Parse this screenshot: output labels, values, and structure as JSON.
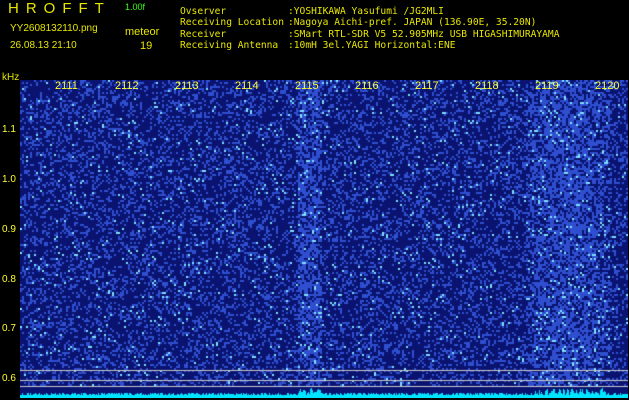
{
  "header": {
    "logo": "HROFFT",
    "version": "1.00f",
    "filename": "YY2608132110.png",
    "meteor_label": "meteor",
    "datetime": "26.08.13 21:10",
    "meteor_count": "19"
  },
  "observation": [
    {
      "label": "Ovserver",
      "value": ":YOSHIKAWA Yasufumi /JG2MLI"
    },
    {
      "label": "Receiving Location",
      "value": ":Nagoya Aichi-pref. JAPAN (136.90E, 35.20N)"
    },
    {
      "label": "Receiver",
      "value": ":SMart RTL-SDR V5 52.905MHz USB HIGASHIMURAYAMA"
    },
    {
      "label": "Receiving Antenna",
      "value": ":10mH 3el.YAGI Horizontal:ENE"
    }
  ],
  "spectrogram": {
    "unit": "kHz",
    "y_ticks": [
      "1.1",
      "1.0",
      "0.9",
      "0.8",
      "0.7",
      "0.6"
    ],
    "x_ticks": [
      "2111",
      "2112",
      "2113",
      "2114",
      "2115",
      "2116",
      "2117",
      "2118",
      "2119",
      "2120"
    ],
    "colors": {
      "background": "#0a1470",
      "noise": "#2f4fd0",
      "bright_noise": "#7fe0ff",
      "baseline": "#00e5ff",
      "tick_text": "#ffff33",
      "reference_line": "#c8c8c8"
    }
  }
}
